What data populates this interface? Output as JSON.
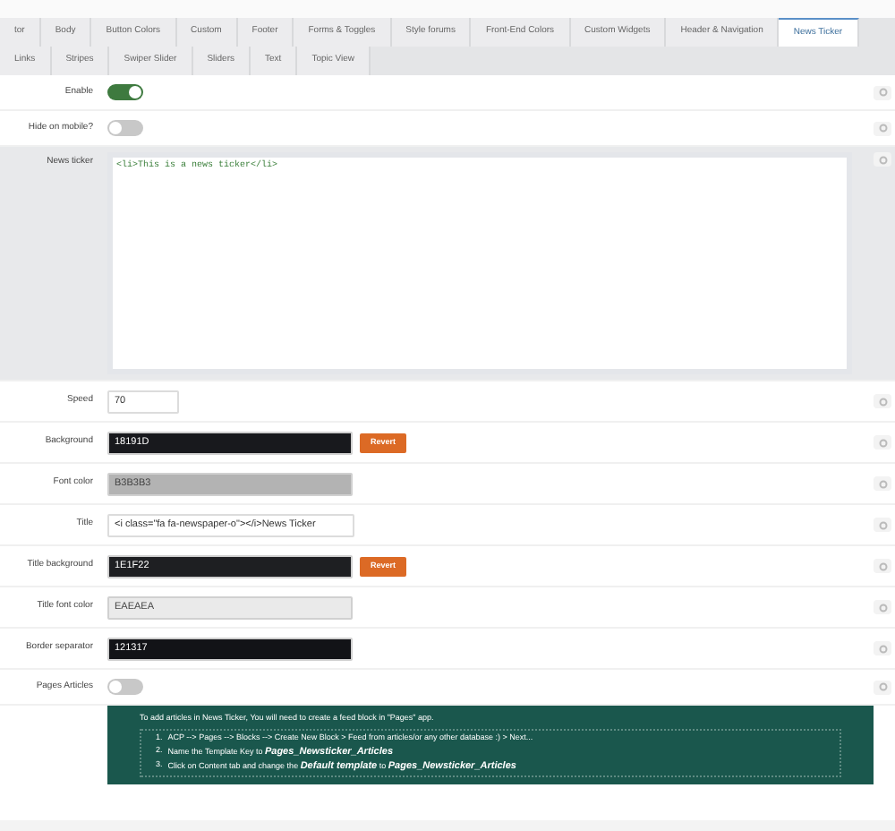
{
  "tab_rows": [
    [
      {
        "label": "tor",
        "selected": false
      },
      {
        "label": "Body",
        "selected": false
      },
      {
        "label": "Button Colors",
        "selected": false
      },
      {
        "label": "Custom",
        "selected": false
      },
      {
        "label": "Footer",
        "selected": false
      },
      {
        "label": "Forms & Toggles",
        "selected": false
      },
      {
        "label": "Style forums",
        "selected": false
      },
      {
        "label": "Front-End Colors",
        "selected": false
      },
      {
        "label": "Custom Widgets",
        "selected": false
      },
      {
        "label": "Header & Navigation",
        "selected": false
      },
      {
        "label": "News Ticker",
        "selected": true
      }
    ],
    [
      {
        "label": "Links",
        "selected": false
      },
      {
        "label": "Stripes",
        "selected": false
      },
      {
        "label": "Swiper Slider",
        "selected": false
      },
      {
        "label": "Sliders",
        "selected": false
      },
      {
        "label": "Text",
        "selected": false
      },
      {
        "label": "Topic View",
        "selected": false
      }
    ]
  ],
  "settings": [
    {
      "kind": "toggle",
      "label": "Enable",
      "on": true
    },
    {
      "kind": "toggle",
      "label": "Hide on mobile?",
      "on": false
    },
    {
      "kind": "code",
      "label": "News ticker",
      "value": "<li>This is a news ticker</li>"
    },
    {
      "kind": "number",
      "label": "Speed",
      "value": "70"
    },
    {
      "kind": "color",
      "label": "Background",
      "value": "18191D",
      "color": "#18191d",
      "revert": "Revert"
    },
    {
      "kind": "color",
      "label": "Font color",
      "value": "B3B3B3",
      "color": "#b3b3b3"
    },
    {
      "kind": "text",
      "label": "Title",
      "value": "<i class=\"fa fa-newspaper-o\"></i>News Ticker"
    },
    {
      "kind": "color",
      "label": "Title background",
      "value": "1E1F22",
      "color": "#1e1f22",
      "revert": "Revert"
    },
    {
      "kind": "color",
      "label": "Title font color",
      "value": "EAEAEA",
      "color": "#eaeaea"
    },
    {
      "kind": "color",
      "label": "Border separator",
      "value": "121317",
      "color": "#121317"
    },
    {
      "kind": "toggle",
      "label": "Pages Articles",
      "on": false
    }
  ],
  "info": {
    "intro": "To add articles in News Ticker, You will need to create a feed block in \"Pages\" app.",
    "steps": [
      {
        "number": "1.",
        "text": "ACP --> Pages --> Blocks --> Create New Block > Feed from articles/or any other database :) > Next..."
      },
      {
        "number": "2.",
        "text": "Name the Template Key to **Pages_Newsticker_Articles**"
      },
      {
        "number": "3.",
        "text": "Click on Content tab and change the **Default template** to **Pages_Newsticker_Articles**"
      }
    ]
  }
}
